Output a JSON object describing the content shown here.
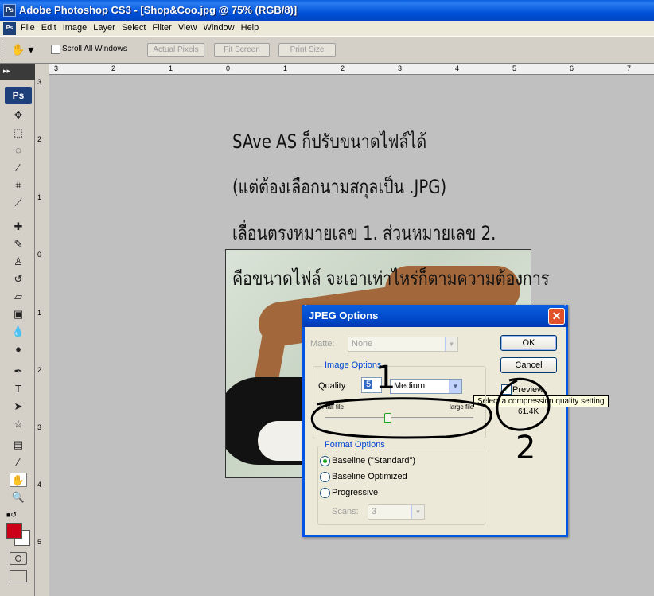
{
  "window": {
    "title": "Adobe Photoshop CS3 - [Shop&Coo.jpg @ 75% (RGB/8)]",
    "app_icon": "Ps"
  },
  "menu": [
    "File",
    "Edit",
    "Image",
    "Layer",
    "Select",
    "Filter",
    "View",
    "Window",
    "Help"
  ],
  "options": {
    "scroll_all_windows": "Scroll All Windows",
    "actual_pixels": "Actual Pixels",
    "fit_screen": "Fit Screen",
    "print_size": "Print Size"
  },
  "toolbox": {
    "logo": "Ps"
  },
  "ruler": {
    "h_ticks": [
      "3",
      "2",
      "1",
      "0",
      "1",
      "2",
      "3",
      "4",
      "5",
      "6",
      "7"
    ],
    "v_ticks": [
      "3",
      "2",
      "1",
      "0",
      "1",
      "2",
      "3",
      "4",
      "5"
    ]
  },
  "annotation": {
    "line1": "SAve AS ก็ปรับขนาดไฟล์ได้",
    "line2": "(แต่ต้องเลือกนามสกุลเป็น .JPG)",
    "line3": "เลื่อนตรงหมายเลข 1. ส่วนหมายเลข 2.",
    "line4": "คือขนาดไฟล์ จะเอาเท่าไหร่ก็ตามความต้องการ",
    "num1": "1",
    "num2": "2"
  },
  "dialog": {
    "title": "JPEG Options",
    "ok": "OK",
    "cancel": "Cancel",
    "preview_label": "Preview",
    "preview_checked": true,
    "file_size": "61.4K",
    "tooltip": "Select a compression quality setting",
    "matte_label": "Matte:",
    "matte_value": "None",
    "image_options_label": "Image Options",
    "quality_label": "Quality:",
    "quality_value": "5",
    "quality_preset": "Medium",
    "small_file": "small file",
    "large_file": "large file",
    "quality_slider_fraction": 0.42,
    "format_options_label": "Format Options",
    "baseline_standard": "Baseline (\"Standard\")",
    "baseline_optimized": "Baseline Optimized",
    "progressive": "Progressive",
    "scans_label": "Scans:",
    "scans_value": "3",
    "selected_format": "baseline_standard"
  },
  "colors": {
    "foreground": "#cc0018",
    "background": "#ffffff",
    "title_bar": "#0054e3"
  }
}
